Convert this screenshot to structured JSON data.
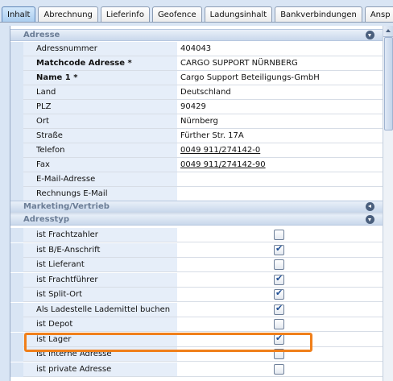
{
  "tabs": [
    "Inhalt",
    "Abrechnung",
    "Lieferinfo",
    "Geofence",
    "Ladungsinhalt",
    "Bankverbindungen",
    "Ansp"
  ],
  "sections": {
    "adresse": "Adresse",
    "marketing": "Marketing/Vertrieb",
    "adresstyp": "Adresstyp"
  },
  "adresse_rows": [
    {
      "label": "Adressnummer",
      "value": "404043"
    },
    {
      "label": "Matchcode Adresse *",
      "value": "CARGO SUPPORT NÜRNBERG"
    },
    {
      "label": "Name 1 *",
      "value": "Cargo Support Beteiligungs-GmbH"
    },
    {
      "label": "Land",
      "value": "Deutschland"
    },
    {
      "label": "PLZ",
      "value": "90429"
    },
    {
      "label": "Ort",
      "value": "Nürnberg"
    },
    {
      "label": "Straße",
      "value": "Fürther Str. 17A"
    },
    {
      "label": "Telefon",
      "value": "0049 911/274142-0"
    },
    {
      "label": "Fax",
      "value": "0049 911/274142-90"
    },
    {
      "label": "E-Mail-Adresse",
      "value": ""
    },
    {
      "label": "Rechnungs E-Mail",
      "value": ""
    }
  ],
  "adresstyp_rows": [
    {
      "label": "ist Frachtzahler",
      "checked": false
    },
    {
      "label": "ist B/E-Anschrift",
      "checked": true
    },
    {
      "label": "ist Lieferant",
      "checked": false
    },
    {
      "label": "ist Frachtführer",
      "checked": true
    },
    {
      "label": "ist Split-Ort",
      "checked": true
    },
    {
      "label": "Als Ladestelle Lademittel buchen",
      "checked": true
    },
    {
      "label": "ist Depot",
      "checked": false
    },
    {
      "label": "ist Lager",
      "checked": true
    },
    {
      "label": "ist interne Adresse",
      "checked": false
    },
    {
      "label": "ist private Adresse",
      "checked": false
    }
  ],
  "icons": {
    "collapse": "chevron-down-circle-icon",
    "expand": "chevron-left-circle-icon",
    "check": "checkmark-icon"
  },
  "colors": {
    "highlight": "#f07f1a",
    "check": "#1f4f95",
    "section_title": "#6b7d96"
  }
}
